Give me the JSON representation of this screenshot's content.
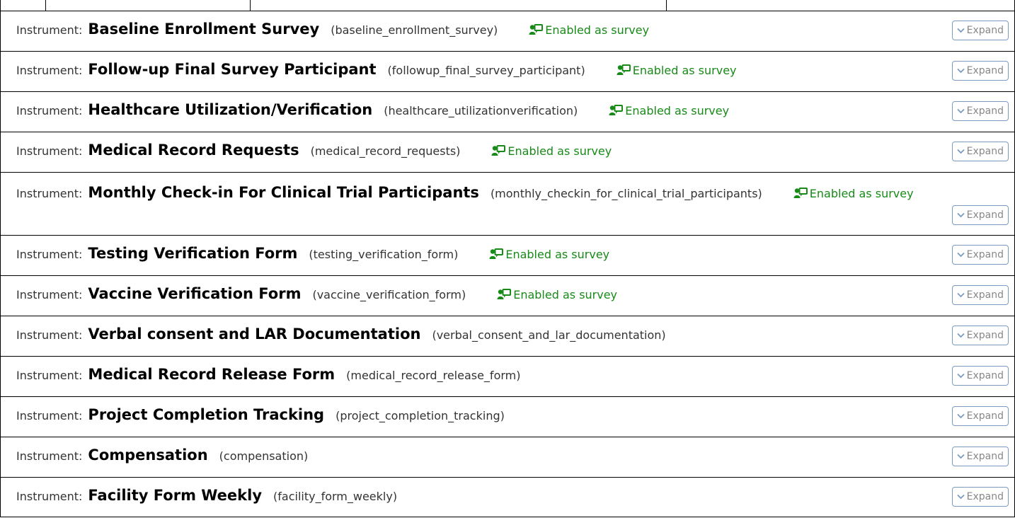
{
  "instrument_label": "Instrument:",
  "survey_text": "Enabled as survey",
  "expand_label": "Expand",
  "colors": {
    "survey_green": "#188a18",
    "button_border": "#7c9bc1"
  },
  "instruments": [
    {
      "title": "Baseline Enrollment Survey",
      "var": "(baseline_enrollment_survey)",
      "survey": true
    },
    {
      "title": "Follow-up Final Survey Participant",
      "var": "(followup_final_survey_participant)",
      "survey": true
    },
    {
      "title": "Healthcare Utilization/Verification",
      "var": "(healthcare_utilizationverification)",
      "survey": true
    },
    {
      "title": "Medical Record Requests",
      "var": "(medical_record_requests)",
      "survey": true
    },
    {
      "title": "Monthly Check-in For Clinical Trial Participants",
      "var": "(monthly_checkin_for_clinical_trial_participants)",
      "survey": true
    },
    {
      "title": "Testing Verification Form",
      "var": "(testing_verification_form)",
      "survey": true
    },
    {
      "title": "Vaccine Verification Form",
      "var": "(vaccine_verification_form)",
      "survey": true
    },
    {
      "title": "Verbal consent and LAR Documentation",
      "var": "(verbal_consent_and_lar_documentation)",
      "survey": false
    },
    {
      "title": "Medical Record Release Form",
      "var": "(medical_record_release_form)",
      "survey": false
    },
    {
      "title": "Project Completion Tracking",
      "var": "(project_completion_tracking)",
      "survey": false
    },
    {
      "title": "Compensation",
      "var": "(compensation)",
      "survey": false
    },
    {
      "title": "Facility Form Weekly",
      "var": "(facility_form_weekly)",
      "survey": false
    }
  ]
}
